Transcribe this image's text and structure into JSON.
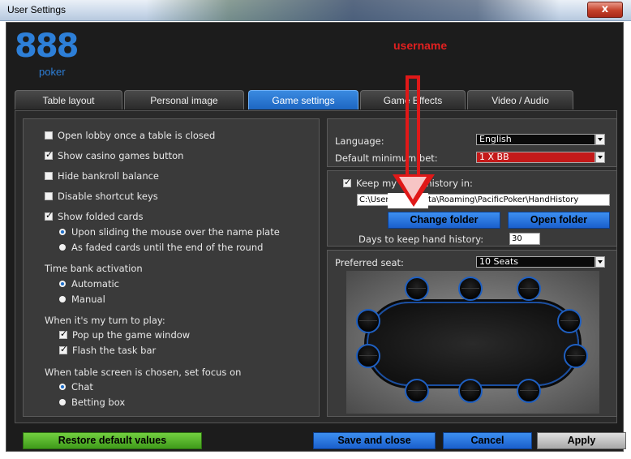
{
  "window": {
    "title": "User Settings",
    "close_label": "x"
  },
  "brand": {
    "logo_number": "888",
    "logo_word": "poker"
  },
  "user": {
    "username": "username"
  },
  "tabs": [
    {
      "label": "Table layout",
      "active": false
    },
    {
      "label": "Personal image",
      "active": false
    },
    {
      "label": "Game settings",
      "active": true
    },
    {
      "label": "Game Effects",
      "active": false
    },
    {
      "label": "Video / Audio",
      "active": false
    }
  ],
  "general": {
    "open_lobby": {
      "label": "Open lobby once a table is closed",
      "checked": false
    },
    "show_casino": {
      "label": "Show casino games button",
      "checked": true
    },
    "hide_bankroll": {
      "label": "Hide bankroll balance",
      "checked": false
    },
    "disable_shortcuts": {
      "label": "Disable shortcut keys",
      "checked": false
    },
    "show_folded": {
      "label": "Show folded cards",
      "checked": true
    },
    "folded_options": [
      {
        "label": "Upon sliding the mouse over the name plate",
        "selected": true
      },
      {
        "label": "As faded cards until the end of the round",
        "selected": false
      }
    ],
    "time_bank": {
      "heading": "Time bank activation",
      "options": [
        {
          "label": "Automatic",
          "selected": true
        },
        {
          "label": "Manual",
          "selected": false
        }
      ]
    },
    "my_turn": {
      "heading": "When it's my turn to play:",
      "popup": {
        "label": "Pop up the game window",
        "checked": true
      },
      "flash": {
        "label": "Flash the task bar",
        "checked": true
      }
    },
    "focus": {
      "heading": "When table screen is chosen, set focus on",
      "options": [
        {
          "label": "Chat",
          "selected": true
        },
        {
          "label": "Betting box",
          "selected": false
        }
      ]
    }
  },
  "language": {
    "label": "Language:",
    "value": "English"
  },
  "min_bet": {
    "label": "Default minimum bet:",
    "value": "1 X BB"
  },
  "hand_history": {
    "label": "Keep my hand history in:",
    "checked": true,
    "path": "C:\\Users\\        \\AppData\\Roaming\\PacificPoker\\HandHistory",
    "change_folder": "Change folder",
    "open_folder": "Open folder",
    "days_label": "Days to keep hand history:",
    "days_value": "30"
  },
  "preferred_seat": {
    "label": "Preferred seat:",
    "value": "10 Seats",
    "seat_count": 10
  },
  "footer": {
    "restore": "Restore default values",
    "save_close": "Save and close",
    "cancel": "Cancel",
    "apply": "Apply"
  },
  "colors": {
    "accent_blue": "#1d66c2",
    "green": "#4fb326",
    "annotation_red": "#e01818",
    "username_red": "#e02020"
  },
  "icons": [
    "close-icon",
    "checkbox-icon",
    "radio-icon",
    "dropdown-arrow-icon",
    "annotation-arrow-icon"
  ]
}
